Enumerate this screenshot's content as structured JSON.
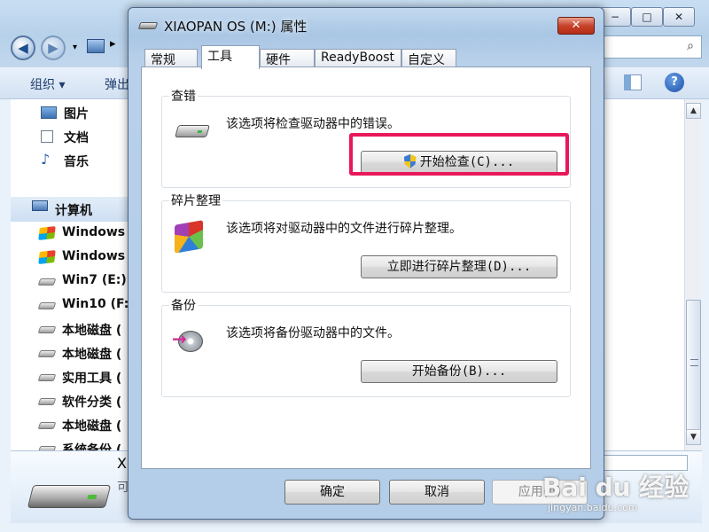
{
  "explorer": {
    "window_buttons": {
      "minimize": "−",
      "maximize": "□",
      "close": "✕"
    },
    "nav": {
      "back": "◀",
      "forward": "▶",
      "path_arrow": "▸"
    },
    "search_icon": "search-icon",
    "toolbar": {
      "organize": "组织 ▾",
      "eject": "弹出"
    },
    "nav_items": [
      {
        "label": "图片",
        "icon": "pictures-icon"
      },
      {
        "label": "文档",
        "icon": "documents-icon"
      },
      {
        "label": "音乐",
        "icon": "music-icon"
      },
      {
        "label": "计算机",
        "icon": "computer-icon"
      },
      {
        "label": "Windows",
        "icon": "windows-drive-icon"
      },
      {
        "label": "Windows",
        "icon": "windows-drive-icon"
      },
      {
        "label": "Win7 (E:)",
        "icon": "drive-icon"
      },
      {
        "label": "Win10 (F:",
        "icon": "drive-icon"
      },
      {
        "label": "本地磁盘 (",
        "icon": "drive-icon"
      },
      {
        "label": "本地磁盘 (",
        "icon": "drive-icon"
      },
      {
        "label": "实用工具 (",
        "icon": "drive-icon"
      },
      {
        "label": "软件分类 (",
        "icon": "drive-icon"
      },
      {
        "label": "本地磁盘 (",
        "icon": "drive-icon"
      },
      {
        "label": "系统备份 (",
        "icon": "drive-icon"
      }
    ],
    "details": {
      "name": "XI",
      "type": "可"
    }
  },
  "dialog": {
    "title": "XIAOPAN OS (M:) 属性",
    "close": "✕",
    "tabs": [
      {
        "label": "常规",
        "active": false
      },
      {
        "label": "工具",
        "active": true
      },
      {
        "label": "硬件",
        "active": false
      },
      {
        "label": "ReadyBoost",
        "active": false
      },
      {
        "label": "自定义",
        "active": false
      }
    ],
    "groups": {
      "check": {
        "title": "查错",
        "description": "该选项将检查驱动器中的错误。",
        "button": "开始检查(C)...",
        "icon": "drive-icon"
      },
      "defrag": {
        "title": "碎片整理",
        "description": "该选项将对驱动器中的文件进行碎片整理。",
        "button": "立即进行碎片整理(D)...",
        "icon": "defrag-icon"
      },
      "backup": {
        "title": "备份",
        "description": "该选项将备份驱动器中的文件。",
        "button": "开始备份(B)...",
        "icon": "backup-icon"
      }
    },
    "footer": {
      "ok": "确定",
      "cancel": "取消",
      "apply": "应用(A)"
    }
  },
  "highlight_color": "#e8185a",
  "watermark": {
    "brand": "Bai du 经验",
    "url": "jingyan.baidu.com"
  }
}
